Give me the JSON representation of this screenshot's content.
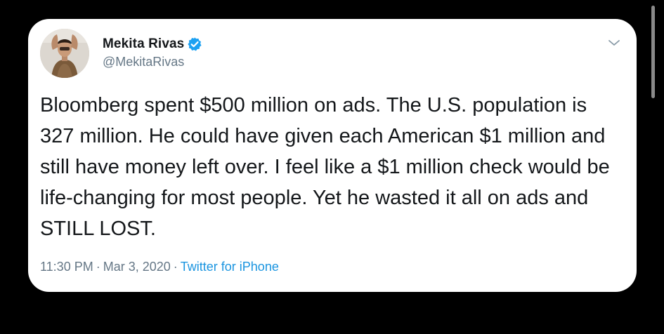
{
  "tweet": {
    "author": {
      "display_name": "Mekita Rivas",
      "handle": "@MekitaRivas",
      "verified": true
    },
    "text": "Bloomberg spent $500 million on ads. The U.S. population is 327 million. He could have given each American $1 million and still have money left over. I feel like a $1 million check would be life-changing for most people. Yet he wasted it all on ads and STILL LOST.",
    "time": "11:30 PM",
    "date": "Mar 3, 2020",
    "separator": "·",
    "source": "Twitter for iPhone"
  },
  "icons": {
    "verified": "verified-badge-icon",
    "menu": "chevron-down-icon"
  },
  "colors": {
    "background": "#000000",
    "card": "#ffffff",
    "text_primary": "#14171a",
    "text_secondary": "#657786",
    "link": "#1b95e0",
    "verified_badge": "#1da1f2"
  }
}
